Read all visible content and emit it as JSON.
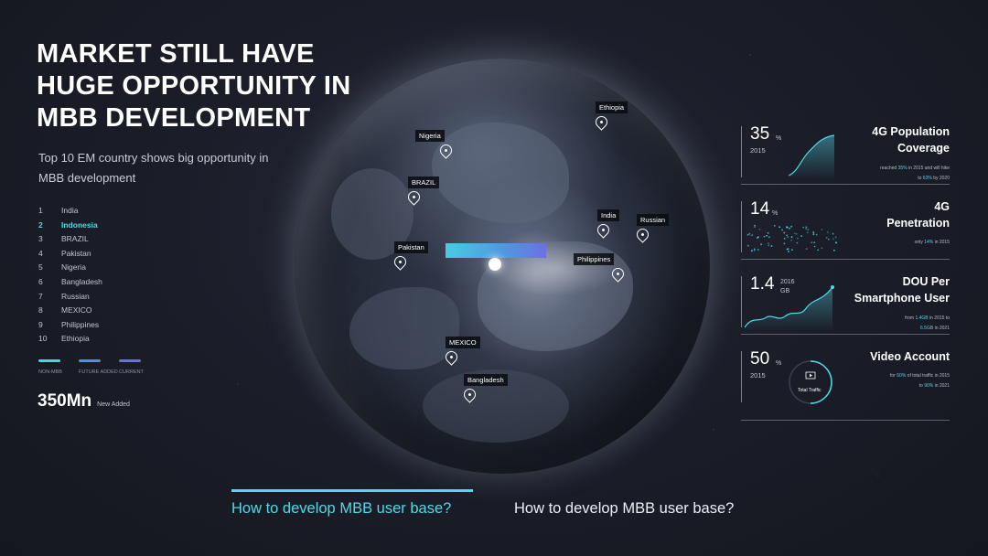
{
  "headline": "MARKET STILL HAVE HUGE OPPORTUNITY IN MBB DEVELOPMENT",
  "subtitle": "Top 10 EM country shows big opportunity in MBB development",
  "countries": [
    {
      "rank": "1",
      "name": "India"
    },
    {
      "rank": "2",
      "name": "Indonesia",
      "active": true
    },
    {
      "rank": "3",
      "name": "BRAZIL"
    },
    {
      "rank": "4",
      "name": "Pakistan"
    },
    {
      "rank": "5",
      "name": "Nigeria"
    },
    {
      "rank": "6",
      "name": "Bangladesh"
    },
    {
      "rank": "7",
      "name": "Russian"
    },
    {
      "rank": "8",
      "name": "MEXICO"
    },
    {
      "rank": "9",
      "name": "Philippines"
    },
    {
      "rank": "10",
      "name": "Ethiopia"
    }
  ],
  "legend": [
    {
      "label": "NON-MBB",
      "color": "#4ad2e8"
    },
    {
      "label": "FUTURE ADDED",
      "color": "#4a8fe8"
    },
    {
      "label": "CURRENT",
      "color": "#6b6ee8"
    }
  ],
  "added": {
    "value": "350Mn",
    "caption": "New Added"
  },
  "map_markers": [
    {
      "name": "Ethiopia",
      "icon": "map-pin-icon"
    },
    {
      "name": "Nigeria",
      "icon": "map-pin-icon"
    },
    {
      "name": "BRAZIL",
      "icon": "map-pin-icon"
    },
    {
      "name": "India",
      "icon": "map-pin-icon"
    },
    {
      "name": "Russian",
      "icon": "map-pin-icon"
    },
    {
      "name": "Pakistan",
      "icon": "map-pin-icon"
    },
    {
      "name": "Philippines",
      "icon": "map-pin-icon"
    },
    {
      "name": "MEXICO",
      "icon": "map-pin-icon"
    },
    {
      "name": "Bangladesh",
      "icon": "map-pin-icon"
    }
  ],
  "stats": {
    "coverage": {
      "value": "35",
      "unit": "%",
      "year": "2015",
      "title_line1": "4G Population",
      "title_line2": "Coverage",
      "desc_1": "reached ",
      "desc_hl1": "35%",
      "desc_2": " in 2015 and will hike",
      "desc_3": "to ",
      "desc_hl2": "63%",
      "desc_4": " by 2020"
    },
    "penetration": {
      "value": "14",
      "unit": "%",
      "title_line1": "4G",
      "title_line2": "Penetration",
      "desc_1": "only ",
      "desc_hl1": "14%",
      "desc_2": " in 2015"
    },
    "dou": {
      "value": "1.4",
      "unit_year": "2016",
      "unit": "GB",
      "title_line1": "DOU Per",
      "title_line2": "Smartphone User",
      "desc_1": "from ",
      "desc_hl1": "1.4GB",
      "desc_2": " in 2015 to",
      "desc_hl2": "6.5GB",
      "desc_3": " in 2021"
    },
    "video": {
      "value": "50",
      "unit": "%",
      "year": "2015",
      "title": "Video Account",
      "donut_label": "Total Traffic",
      "donut_fraction": 0.5,
      "desc_1": "for ",
      "desc_hl1": "50%",
      "desc_2": " of total traffic in 2015",
      "desc_3": "to ",
      "desc_hl2": "90%",
      "desc_4": " in 2021"
    }
  },
  "tabs": [
    {
      "label": "How to develop MBB user base?",
      "active": true
    },
    {
      "label": "How to develop MBB user base?",
      "active": false
    }
  ],
  "colors": {
    "accent": "#52d8e6",
    "background": "#1b1e29"
  }
}
